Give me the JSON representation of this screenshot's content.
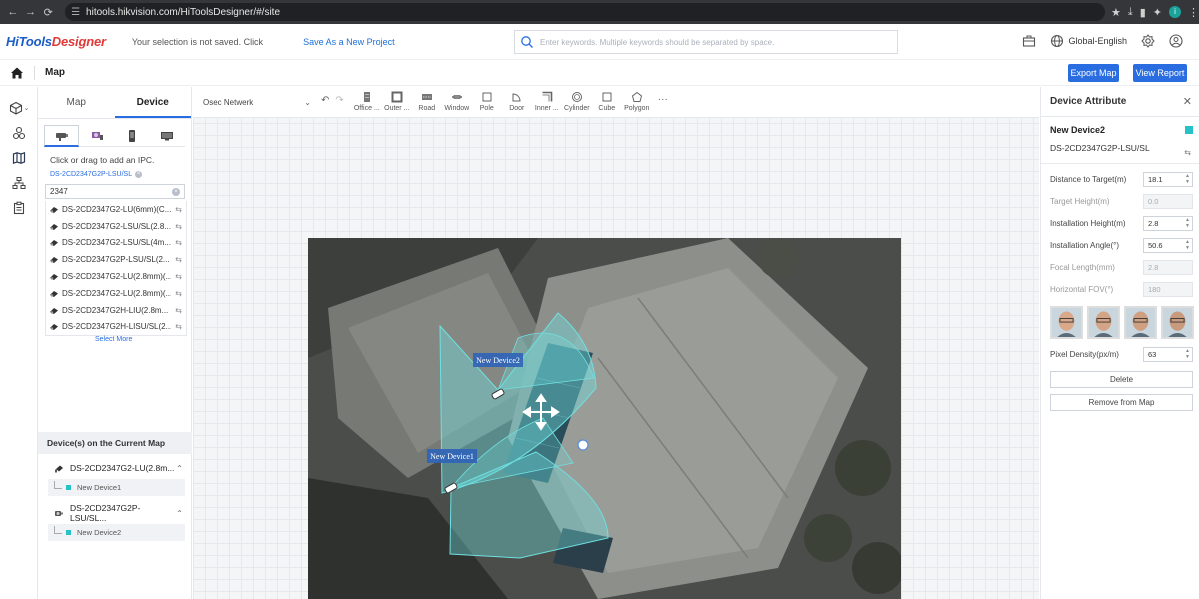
{
  "browser": {
    "url": "hitools.hikvision.com/HiToolsDesigner/#/site"
  },
  "header": {
    "logo_part1": "HiTools",
    "logo_part2": "Designer",
    "unsaved_text": "Your selection is not saved. Click",
    "save_link": "Save As a New Project",
    "search_placeholder": "Enter keywords. Multiple keywords should be separated by space.",
    "language": "Global-English",
    "accent_color": "#2a6de1"
  },
  "title_bar": {
    "title": "Map",
    "export_map": "Export Map",
    "view_report": "View Report"
  },
  "left_panel": {
    "tabs": [
      "Map",
      "Device"
    ],
    "active_tab": "Device",
    "hint": "Click or drag to add an IPC.",
    "selected_chip": "DS-2CD2347G2P-LSU/SL",
    "search_value": "2347",
    "results": [
      "DS-2CD2347G2-LU(6mm)(C...",
      "DS-2CD2347G2-LSU/SL(2.8...",
      "DS-2CD2347G2-LSU/SL(4m...",
      "DS-2CD2347G2P-LSU/SL(2...",
      "DS-2CD2347G2-LU(2.8mm)(...",
      "DS-2CD2347G2-LU(2.8mm)(...",
      "DS-2CD2347G2H-LIU(2.8m...",
      "DS-2CD2347G2H-LISU/SL(2..."
    ],
    "select_more": "Select More",
    "current_map_header": "Device(s) on the Current Map",
    "current_devices": [
      {
        "model": "DS-2CD2347G2-LU(2.8m...",
        "name": "New Device1"
      },
      {
        "model": "DS-2CD2347G2P-LSU/SL...",
        "name": "New Device2"
      }
    ]
  },
  "toolbar": {
    "network": "Osec Netwerk",
    "tools": [
      "Office ...",
      "Outer ...",
      "Road",
      "Window",
      "Pole",
      "Door",
      "Inner ...",
      "Cylinder",
      "Cube",
      "Polygon"
    ]
  },
  "map": {
    "device_labels": [
      "New Device2",
      "New Device1"
    ],
    "fov_color": "#6fe0e0"
  },
  "right_panel": {
    "title": "Device Attribute",
    "device_name": "New Device2",
    "device_model": "DS-2CD2347G2P-LSU/SL",
    "device_color": "#27c2c8",
    "fields": [
      {
        "label": "Distance to Target(m)",
        "value": "18.1",
        "disabled": false
      },
      {
        "label": "Target Height(m)",
        "value": "0.0",
        "disabled": true
      },
      {
        "label": "Installation Height(m)",
        "value": "2.8",
        "disabled": false
      },
      {
        "label": "Installation Angle(°)",
        "value": "50.6",
        "disabled": false
      },
      {
        "label": "Focal Length(mm)",
        "value": "2.8",
        "disabled": true
      },
      {
        "label": "Horizontal FOV(°)",
        "value": "180",
        "disabled": true
      }
    ],
    "pixel_density_label": "Pixel Density(px/m)",
    "pixel_density_value": "63",
    "delete": "Delete",
    "remove_from_map": "Remove from Map"
  }
}
